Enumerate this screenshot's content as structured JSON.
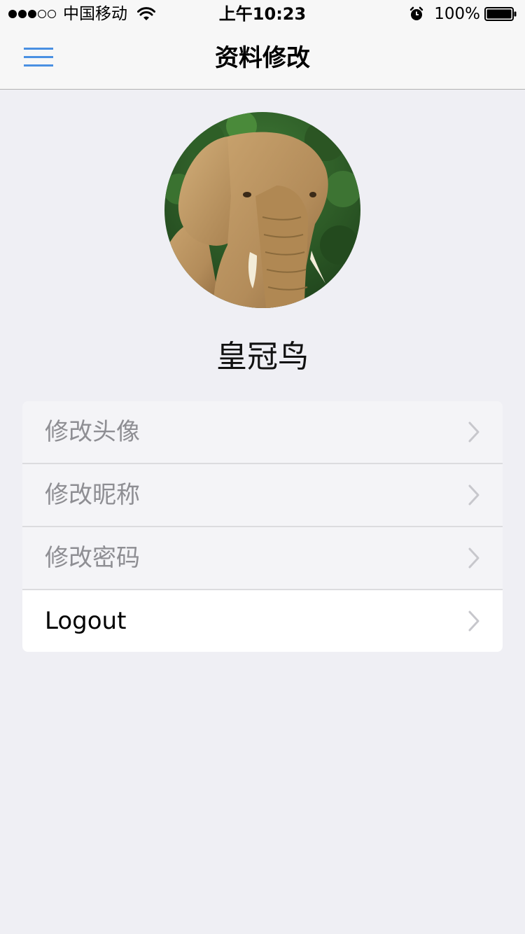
{
  "status_bar": {
    "carrier": "中国移动",
    "time": "上午10:23",
    "battery_percent": "100%",
    "signal_strength": 3,
    "signal_max": 5,
    "icons": [
      "wifi-icon",
      "alarm-icon",
      "battery-icon"
    ]
  },
  "nav": {
    "title": "资料修改",
    "menu_icon": "hamburger-menu-icon",
    "accent_color": "#4a90e2"
  },
  "profile": {
    "nickname": "皇冠鸟",
    "avatar": "elephant-photo"
  },
  "menu": {
    "items": [
      {
        "label": "修改头像",
        "icon": "chevron-right-icon"
      },
      {
        "label": "修改昵称",
        "icon": "chevron-right-icon"
      },
      {
        "label": "修改密码",
        "icon": "chevron-right-icon"
      },
      {
        "label": "Logout",
        "icon": "chevron-right-icon"
      }
    ]
  }
}
